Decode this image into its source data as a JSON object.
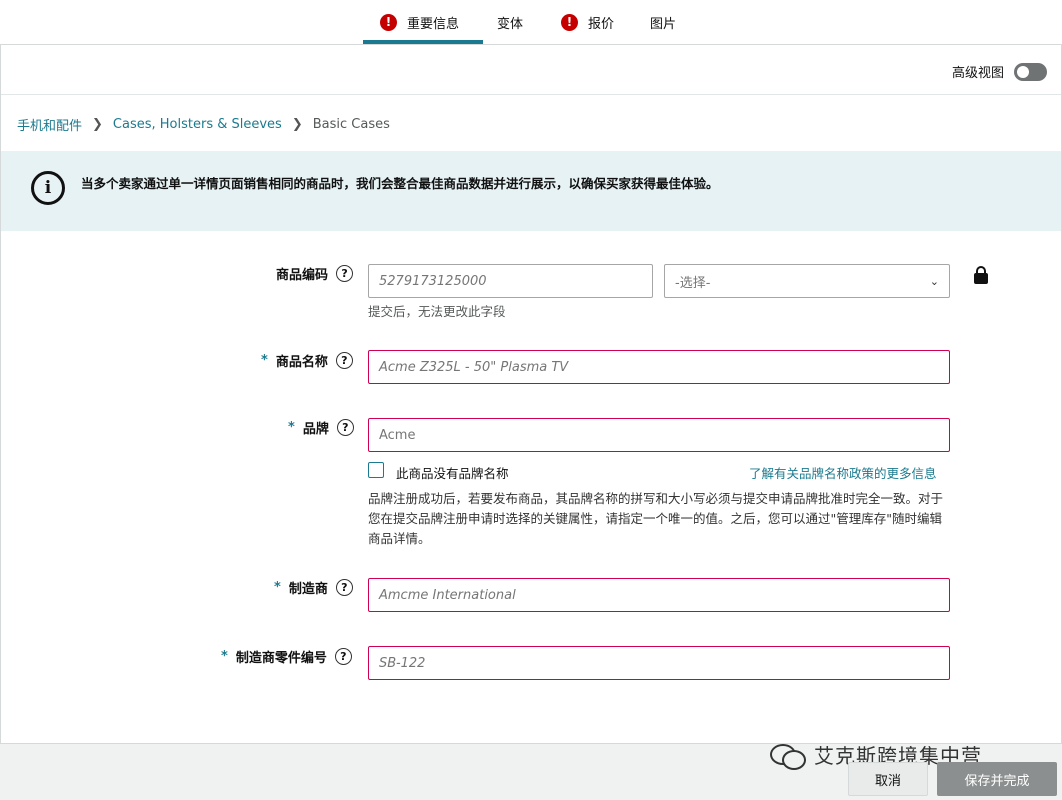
{
  "tabs": [
    {
      "label": "重要信息",
      "warning": true,
      "active": true
    },
    {
      "label": "变体",
      "warning": false,
      "active": false
    },
    {
      "label": "报价",
      "warning": true,
      "active": false
    },
    {
      "label": "图片",
      "warning": false,
      "active": false
    }
  ],
  "advanced_view": {
    "label": "高级视图",
    "enabled": false
  },
  "breadcrumb": {
    "items": [
      "手机和配件",
      "Cases, Holsters & Sleeves",
      "Basic Cases"
    ]
  },
  "info_banner": {
    "text": "当多个卖家通过单一详情页面销售相同的商品时，我们会整合最佳商品数据并进行展示，以确保买家获得最佳体验。"
  },
  "form": {
    "product_id": {
      "label": "商品编码",
      "value": "5279173125000",
      "type_placeholder": "-选择-",
      "hint": "提交后，无法更改此字段"
    },
    "product_name": {
      "label": "商品名称",
      "required": "*",
      "placeholder": "Acme Z325L - 50\" Plasma TV"
    },
    "brand": {
      "label": "品牌",
      "required": "*",
      "value": "Acme",
      "no_brand_label": "此商品没有品牌名称",
      "learn_more": "了解有关品牌名称政策的更多信息",
      "note": "品牌注册成功后，若要发布商品，其品牌名称的拼写和大小写必须与提交申请品牌批准时完全一致。对于您在提交品牌注册申请时选择的关键属性，请指定一个唯一的值。之后，您可以通过\"管理库存\"随时编辑商品详情。"
    },
    "manufacturer": {
      "label": "制造商",
      "required": "*",
      "placeholder": "Amcme International"
    },
    "part_number": {
      "label": "制造商零件编号",
      "required": "*",
      "placeholder": "SB-122"
    }
  },
  "buttons": {
    "cancel": "取消",
    "save": "保存并完成"
  },
  "watermark": {
    "text": "艾克斯跨境集中营"
  }
}
